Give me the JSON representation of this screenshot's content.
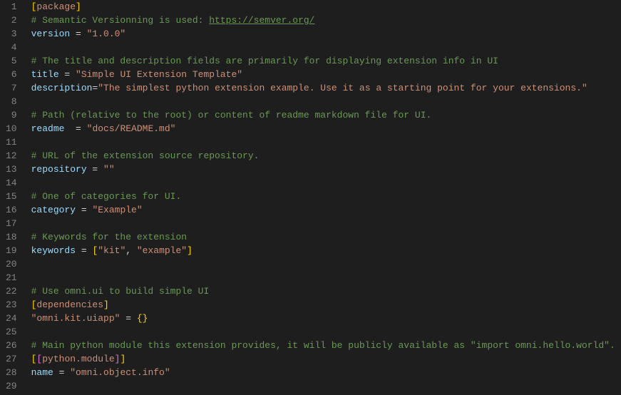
{
  "lines": [
    {
      "n": "1",
      "tokens": [
        {
          "c": "bracket-y",
          "t": "["
        },
        {
          "c": "section",
          "t": "package"
        },
        {
          "c": "bracket-y",
          "t": "]"
        }
      ]
    },
    {
      "n": "2",
      "tokens": [
        {
          "c": "comment",
          "t": "# Semantic Versionning is used: "
        },
        {
          "c": "link",
          "t": "https://semver.org/"
        }
      ]
    },
    {
      "n": "3",
      "tokens": [
        {
          "c": "key",
          "t": "version"
        },
        {
          "c": "op",
          "t": " = "
        },
        {
          "c": "string",
          "t": "\"1.0.0\""
        }
      ]
    },
    {
      "n": "4",
      "tokens": []
    },
    {
      "n": "5",
      "tokens": [
        {
          "c": "comment",
          "t": "# The title and description fields are primarily for displaying extension info in UI"
        }
      ]
    },
    {
      "n": "6",
      "tokens": [
        {
          "c": "key",
          "t": "title"
        },
        {
          "c": "op",
          "t": " = "
        },
        {
          "c": "string",
          "t": "\"Simple UI Extension Template\""
        }
      ]
    },
    {
      "n": "7",
      "tokens": [
        {
          "c": "key",
          "t": "description"
        },
        {
          "c": "op",
          "t": "="
        },
        {
          "c": "string",
          "t": "\"The simplest python extension example. Use it as a starting point for your extensions.\""
        }
      ]
    },
    {
      "n": "8",
      "tokens": []
    },
    {
      "n": "9",
      "tokens": [
        {
          "c": "comment",
          "t": "# Path (relative to the root) or content of readme markdown file for UI."
        }
      ]
    },
    {
      "n": "10",
      "tokens": [
        {
          "c": "key",
          "t": "readme"
        },
        {
          "c": "op",
          "t": "  = "
        },
        {
          "c": "string",
          "t": "\"docs/README.md\""
        }
      ]
    },
    {
      "n": "11",
      "tokens": []
    },
    {
      "n": "12",
      "tokens": [
        {
          "c": "comment",
          "t": "# URL of the extension source repository."
        }
      ]
    },
    {
      "n": "13",
      "tokens": [
        {
          "c": "key",
          "t": "repository"
        },
        {
          "c": "op",
          "t": " = "
        },
        {
          "c": "string",
          "t": "\"\""
        }
      ]
    },
    {
      "n": "14",
      "tokens": []
    },
    {
      "n": "15",
      "tokens": [
        {
          "c": "comment",
          "t": "# One of categories for UI."
        }
      ]
    },
    {
      "n": "16",
      "tokens": [
        {
          "c": "key",
          "t": "category"
        },
        {
          "c": "op",
          "t": " = "
        },
        {
          "c": "string",
          "t": "\"Example\""
        }
      ]
    },
    {
      "n": "17",
      "tokens": []
    },
    {
      "n": "18",
      "tokens": [
        {
          "c": "comment",
          "t": "# Keywords for the extension"
        }
      ]
    },
    {
      "n": "19",
      "tokens": [
        {
          "c": "key",
          "t": "keywords"
        },
        {
          "c": "op",
          "t": " = "
        },
        {
          "c": "bracket-y",
          "t": "["
        },
        {
          "c": "string",
          "t": "\"kit\""
        },
        {
          "c": "op",
          "t": ", "
        },
        {
          "c": "string",
          "t": "\"example\""
        },
        {
          "c": "bracket-y",
          "t": "]"
        }
      ]
    },
    {
      "n": "20",
      "tokens": []
    },
    {
      "n": "21",
      "tokens": []
    },
    {
      "n": "22",
      "tokens": [
        {
          "c": "comment",
          "t": "# Use omni.ui to build simple UI"
        }
      ]
    },
    {
      "n": "23",
      "tokens": [
        {
          "c": "bracket-y",
          "t": "["
        },
        {
          "c": "section",
          "t": "dependencies"
        },
        {
          "c": "bracket-y",
          "t": "]"
        }
      ]
    },
    {
      "n": "24",
      "tokens": [
        {
          "c": "string",
          "t": "\"omni.kit.uiapp\""
        },
        {
          "c": "op",
          "t": " = "
        },
        {
          "c": "bracket-y",
          "t": "{"
        },
        {
          "c": "bracket-y",
          "t": "}"
        }
      ]
    },
    {
      "n": "25",
      "tokens": []
    },
    {
      "n": "26",
      "tokens": [
        {
          "c": "comment",
          "t": "# Main python module this extension provides, it will be publicly available as \"import omni.hello.world\"."
        }
      ]
    },
    {
      "n": "27",
      "tokens": [
        {
          "c": "bracket-y",
          "t": "["
        },
        {
          "c": "bracket-p",
          "t": "["
        },
        {
          "c": "section",
          "t": "python.module"
        },
        {
          "c": "bracket-p",
          "t": "]"
        },
        {
          "c": "bracket-y",
          "t": "]"
        }
      ]
    },
    {
      "n": "28",
      "tokens": [
        {
          "c": "key",
          "t": "name"
        },
        {
          "c": "op",
          "t": " = "
        },
        {
          "c": "string",
          "t": "\"omni.object.info\""
        }
      ]
    },
    {
      "n": "29",
      "tokens": []
    }
  ]
}
